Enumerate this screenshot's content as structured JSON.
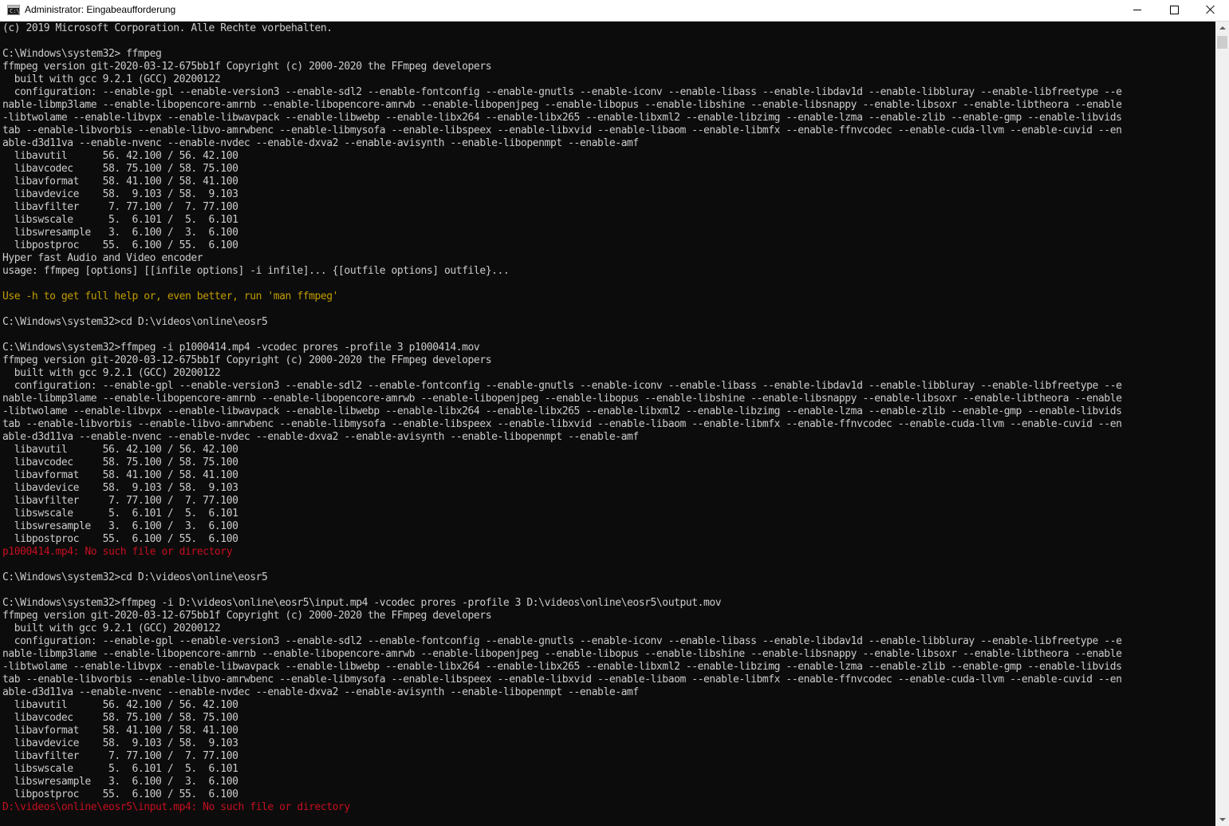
{
  "window": {
    "title": "Administrator: Eingabeaufforderung",
    "icon_name": "cmd-icon",
    "icon_glyph": "C:\\",
    "buttons": {
      "minimize": "minimize-icon",
      "maximize": "maximize-icon",
      "close": "close-icon"
    }
  },
  "colors": {
    "background": "#0c0c0c",
    "text": "#cccccc",
    "warning": "#c19c00",
    "error": "#c50f1f"
  },
  "console": {
    "lines": [
      {
        "text": "(c) 2019 Microsoft Corporation. Alle Rechte vorbehalten.",
        "style": "normal"
      },
      {
        "text": "",
        "style": "normal"
      },
      {
        "text": "C:\\Windows\\system32> ffmpeg",
        "style": "normal"
      },
      {
        "text": "ffmpeg version git-2020-03-12-675bb1f Copyright (c) 2000-2020 the FFmpeg developers",
        "style": "normal"
      },
      {
        "text": "  built with gcc 9.2.1 (GCC) 20200122",
        "style": "normal"
      },
      {
        "text": "  configuration: --enable-gpl --enable-version3 --enable-sdl2 --enable-fontconfig --enable-gnutls --enable-iconv --enable-libass --enable-libdav1d --enable-libbluray --enable-libfreetype --e",
        "style": "normal"
      },
      {
        "text": "nable-libmp3lame --enable-libopencore-amrnb --enable-libopencore-amrwb --enable-libopenjpeg --enable-libopus --enable-libshine --enable-libsnappy --enable-libsoxr --enable-libtheora --enable",
        "style": "normal"
      },
      {
        "text": "-libtwolame --enable-libvpx --enable-libwavpack --enable-libwebp --enable-libx264 --enable-libx265 --enable-libxml2 --enable-libzimg --enable-lzma --enable-zlib --enable-gmp --enable-libvids",
        "style": "normal"
      },
      {
        "text": "tab --enable-libvorbis --enable-libvo-amrwbenc --enable-libmysofa --enable-libspeex --enable-libxvid --enable-libaom --enable-libmfx --enable-ffnvcodec --enable-cuda-llvm --enable-cuvid --en",
        "style": "normal"
      },
      {
        "text": "able-d3d11va --enable-nvenc --enable-nvdec --enable-dxva2 --enable-avisynth --enable-libopenmpt --enable-amf",
        "style": "normal"
      },
      {
        "text": "  libavutil      56. 42.100 / 56. 42.100",
        "style": "normal"
      },
      {
        "text": "  libavcodec     58. 75.100 / 58. 75.100",
        "style": "normal"
      },
      {
        "text": "  libavformat    58. 41.100 / 58. 41.100",
        "style": "normal"
      },
      {
        "text": "  libavdevice    58.  9.103 / 58.  9.103",
        "style": "normal"
      },
      {
        "text": "  libavfilter     7. 77.100 /  7. 77.100",
        "style": "normal"
      },
      {
        "text": "  libswscale      5.  6.101 /  5.  6.101",
        "style": "normal"
      },
      {
        "text": "  libswresample   3.  6.100 /  3.  6.100",
        "style": "normal"
      },
      {
        "text": "  libpostproc    55.  6.100 / 55.  6.100",
        "style": "normal"
      },
      {
        "text": "Hyper fast Audio and Video encoder",
        "style": "normal"
      },
      {
        "text": "usage: ffmpeg [options] [[infile options] -i infile]... {[outfile options] outfile}...",
        "style": "normal"
      },
      {
        "text": "",
        "style": "normal"
      },
      {
        "text": "Use -h to get full help or, even better, run 'man ffmpeg'",
        "style": "yellow"
      },
      {
        "text": "",
        "style": "normal"
      },
      {
        "text": "C:\\Windows\\system32>cd D:\\videos\\online\\eosr5",
        "style": "normal"
      },
      {
        "text": "",
        "style": "normal"
      },
      {
        "text": "C:\\Windows\\system32>ffmpeg -i p1000414.mp4 -vcodec prores -profile 3 p1000414.mov",
        "style": "normal"
      },
      {
        "text": "ffmpeg version git-2020-03-12-675bb1f Copyright (c) 2000-2020 the FFmpeg developers",
        "style": "normal"
      },
      {
        "text": "  built with gcc 9.2.1 (GCC) 20200122",
        "style": "normal"
      },
      {
        "text": "  configuration: --enable-gpl --enable-version3 --enable-sdl2 --enable-fontconfig --enable-gnutls --enable-iconv --enable-libass --enable-libdav1d --enable-libbluray --enable-libfreetype --e",
        "style": "normal"
      },
      {
        "text": "nable-libmp3lame --enable-libopencore-amrnb --enable-libopencore-amrwb --enable-libopenjpeg --enable-libopus --enable-libshine --enable-libsnappy --enable-libsoxr --enable-libtheora --enable",
        "style": "normal"
      },
      {
        "text": "-libtwolame --enable-libvpx --enable-libwavpack --enable-libwebp --enable-libx264 --enable-libx265 --enable-libxml2 --enable-libzimg --enable-lzma --enable-zlib --enable-gmp --enable-libvids",
        "style": "normal"
      },
      {
        "text": "tab --enable-libvorbis --enable-libvo-amrwbenc --enable-libmysofa --enable-libspeex --enable-libxvid --enable-libaom --enable-libmfx --enable-ffnvcodec --enable-cuda-llvm --enable-cuvid --en",
        "style": "normal"
      },
      {
        "text": "able-d3d11va --enable-nvenc --enable-nvdec --enable-dxva2 --enable-avisynth --enable-libopenmpt --enable-amf",
        "style": "normal"
      },
      {
        "text": "  libavutil      56. 42.100 / 56. 42.100",
        "style": "normal"
      },
      {
        "text": "  libavcodec     58. 75.100 / 58. 75.100",
        "style": "normal"
      },
      {
        "text": "  libavformat    58. 41.100 / 58. 41.100",
        "style": "normal"
      },
      {
        "text": "  libavdevice    58.  9.103 / 58.  9.103",
        "style": "normal"
      },
      {
        "text": "  libavfilter     7. 77.100 /  7. 77.100",
        "style": "normal"
      },
      {
        "text": "  libswscale      5.  6.101 /  5.  6.101",
        "style": "normal"
      },
      {
        "text": "  libswresample   3.  6.100 /  3.  6.100",
        "style": "normal"
      },
      {
        "text": "  libpostproc    55.  6.100 / 55.  6.100",
        "style": "normal"
      },
      {
        "text": "p1000414.mp4: No such file or directory",
        "style": "red"
      },
      {
        "text": "",
        "style": "normal"
      },
      {
        "text": "C:\\Windows\\system32>cd D:\\videos\\online\\eosr5",
        "style": "normal"
      },
      {
        "text": "",
        "style": "normal"
      },
      {
        "text": "C:\\Windows\\system32>ffmpeg -i D:\\videos\\online\\eosr5\\input.mp4 -vcodec prores -profile 3 D:\\videos\\online\\eosr5\\output.mov",
        "style": "normal"
      },
      {
        "text": "ffmpeg version git-2020-03-12-675bb1f Copyright (c) 2000-2020 the FFmpeg developers",
        "style": "normal"
      },
      {
        "text": "  built with gcc 9.2.1 (GCC) 20200122",
        "style": "normal"
      },
      {
        "text": "  configuration: --enable-gpl --enable-version3 --enable-sdl2 --enable-fontconfig --enable-gnutls --enable-iconv --enable-libass --enable-libdav1d --enable-libbluray --enable-libfreetype --e",
        "style": "normal"
      },
      {
        "text": "nable-libmp3lame --enable-libopencore-amrnb --enable-libopencore-amrwb --enable-libopenjpeg --enable-libopus --enable-libshine --enable-libsnappy --enable-libsoxr --enable-libtheora --enable",
        "style": "normal"
      },
      {
        "text": "-libtwolame --enable-libvpx --enable-libwavpack --enable-libwebp --enable-libx264 --enable-libx265 --enable-libxml2 --enable-libzimg --enable-lzma --enable-zlib --enable-gmp --enable-libvids",
        "style": "normal"
      },
      {
        "text": "tab --enable-libvorbis --enable-libvo-amrwbenc --enable-libmysofa --enable-libspeex --enable-libxvid --enable-libaom --enable-libmfx --enable-ffnvcodec --enable-cuda-llvm --enable-cuvid --en",
        "style": "normal"
      },
      {
        "text": "able-d3d11va --enable-nvenc --enable-nvdec --enable-dxva2 --enable-avisynth --enable-libopenmpt --enable-amf",
        "style": "normal"
      },
      {
        "text": "  libavutil      56. 42.100 / 56. 42.100",
        "style": "normal"
      },
      {
        "text": "  libavcodec     58. 75.100 / 58. 75.100",
        "style": "normal"
      },
      {
        "text": "  libavformat    58. 41.100 / 58. 41.100",
        "style": "normal"
      },
      {
        "text": "  libavdevice    58.  9.103 / 58.  9.103",
        "style": "normal"
      },
      {
        "text": "  libavfilter     7. 77.100 /  7. 77.100",
        "style": "normal"
      },
      {
        "text": "  libswscale      5.  6.101 /  5.  6.101",
        "style": "normal"
      },
      {
        "text": "  libswresample   3.  6.100 /  3.  6.100",
        "style": "normal"
      },
      {
        "text": "  libpostproc    55.  6.100 / 55.  6.100",
        "style": "normal"
      },
      {
        "text": "D:\\videos\\online\\eosr5\\input.mp4: No such file or directory",
        "style": "red"
      }
    ]
  },
  "scrollbar": {
    "position_fraction": 0.0
  }
}
